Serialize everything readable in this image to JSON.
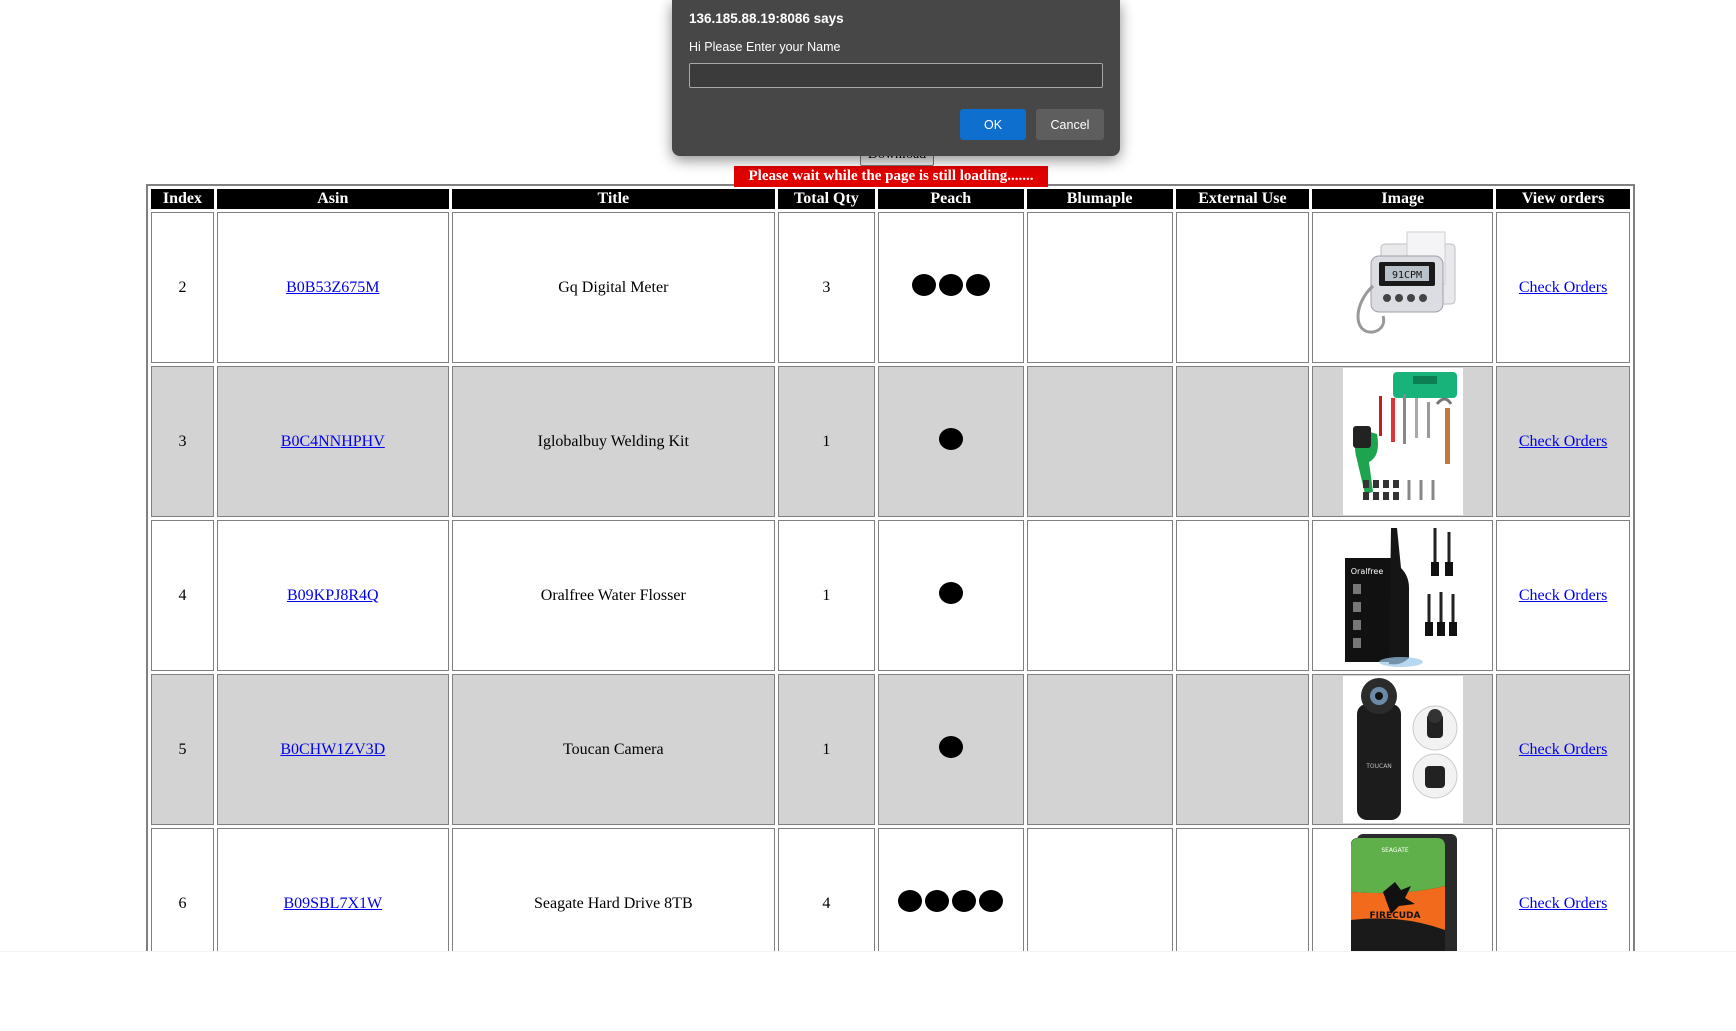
{
  "toolbar": {
    "download_label": "Download"
  },
  "loading_message": "Please wait while the page is still loading.......",
  "table": {
    "headers": [
      "Index",
      "Asin",
      "Title",
      "Total Qty",
      "Peach",
      "Blumaple",
      "External Use",
      "Image",
      "View orders"
    ],
    "rows": [
      {
        "index": "2",
        "asin": "B0B53Z675M",
        "title": "Gq Digital Meter",
        "total_qty": "3",
        "peach_dots": 3,
        "blumaple": "",
        "external_use": "",
        "image": "digital-meter-image",
        "link": "Check Orders"
      },
      {
        "index": "3",
        "asin": "B0C4NNHPHV",
        "title": "Iglobalbuy Welding Kit",
        "total_qty": "1",
        "peach_dots": 1,
        "blumaple": "",
        "external_use": "",
        "image": "welding-kit-image",
        "link": "Check Orders"
      },
      {
        "index": "4",
        "asin": "B09KPJ8R4Q",
        "title": "Oralfree Water Flosser",
        "total_qty": "1",
        "peach_dots": 1,
        "blumaple": "",
        "external_use": "",
        "image": "water-flosser-image",
        "link": "Check Orders"
      },
      {
        "index": "5",
        "asin": "B0CHW1ZV3D",
        "title": "Toucan Camera",
        "total_qty": "1",
        "peach_dots": 1,
        "blumaple": "",
        "external_use": "",
        "image": "camera-image",
        "link": "Check Orders"
      },
      {
        "index": "6",
        "asin": "B09SBL7X1W",
        "title": "Seagate Hard Drive 8TB",
        "total_qty": "4",
        "peach_dots": 4,
        "blumaple": "",
        "external_use": "",
        "image": "hard-drive-image",
        "link": "Check Orders"
      }
    ]
  },
  "dialog": {
    "title": "136.185.88.19:8086 says",
    "message": "Hi Please Enter your Name",
    "input_value": "",
    "ok_label": "OK",
    "cancel_label": "Cancel"
  },
  "colors": {
    "loading_bg": "#e00000",
    "header_bg": "#000000",
    "alt_row_bg": "#d3d3d3",
    "link": "#0000ee",
    "dialog_bg": "#474747",
    "ok_button": "#0e6fcf"
  },
  "image_graphics": {
    "meter_screen": "91CPM",
    "drive_brand": "SEAGATE",
    "drive_model": "FIRECUDA",
    "flosser_brand": "Oralfree",
    "camera_brand": "TOUCAN"
  }
}
